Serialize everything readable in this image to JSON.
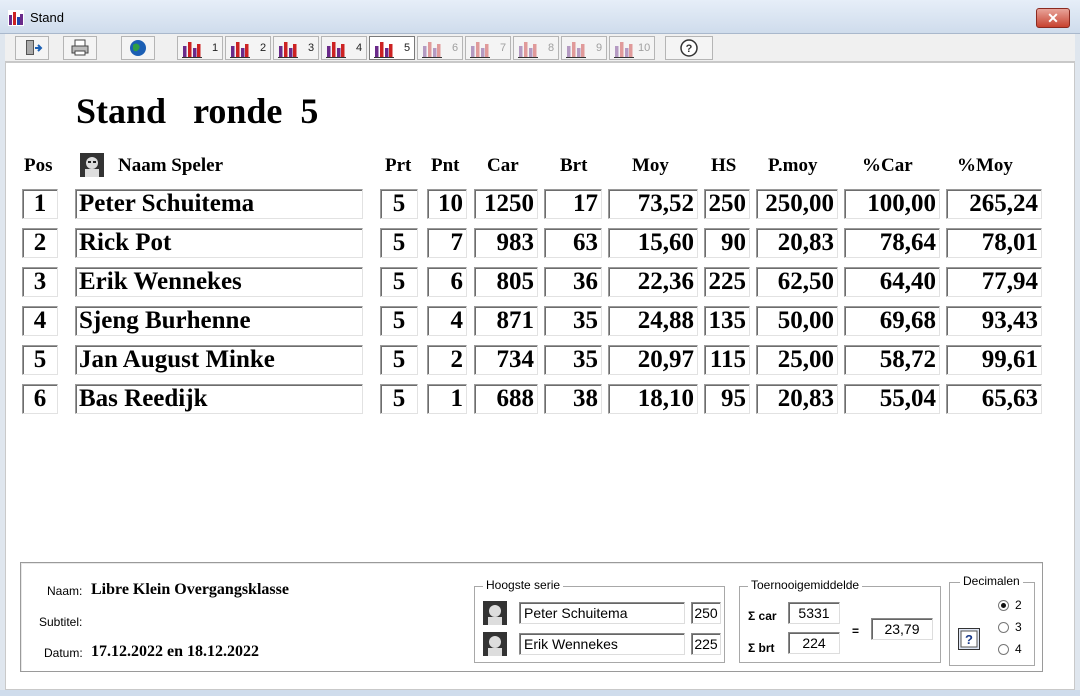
{
  "window": {
    "title": "Stand",
    "close_glyph": "✕"
  },
  "toolbar": {
    "round_numbers": [
      "1",
      "2",
      "3",
      "4",
      "5",
      "6",
      "7",
      "8",
      "9",
      "10"
    ],
    "active_round": "5",
    "help_glyph": "?"
  },
  "heading": {
    "word": "Stand",
    "round_word": "ronde",
    "round_number": "5"
  },
  "columns": {
    "pos": "Pos",
    "name": "Naam Speler",
    "prt": "Prt",
    "pnt": "Pnt",
    "car": "Car",
    "brt": "Brt",
    "moy": "Moy",
    "hs": "HS",
    "pmoy": "P.moy",
    "pcar": "%Car",
    "pmoy2": "%Moy"
  },
  "rows": [
    {
      "pos": "1",
      "name": "Peter Schuitema",
      "prt": "5",
      "pnt": "10",
      "car": "1250",
      "brt": "17",
      "moy": "73,52",
      "hs": "250",
      "pmoy": "250,00",
      "pcar": "100,00",
      "pmoy2": "265,24"
    },
    {
      "pos": "2",
      "name": "Rick Pot",
      "prt": "5",
      "pnt": "7",
      "car": "983",
      "brt": "63",
      "moy": "15,60",
      "hs": "90",
      "pmoy": "20,83",
      "pcar": "78,64",
      "pmoy2": "78,01"
    },
    {
      "pos": "3",
      "name": "Erik Wennekes",
      "prt": "5",
      "pnt": "6",
      "car": "805",
      "brt": "36",
      "moy": "22,36",
      "hs": "225",
      "pmoy": "62,50",
      "pcar": "64,40",
      "pmoy2": "77,94"
    },
    {
      "pos": "4",
      "name": "Sjeng Burhenne",
      "prt": "5",
      "pnt": "4",
      "car": "871",
      "brt": "35",
      "moy": "24,88",
      "hs": "135",
      "pmoy": "50,00",
      "pcar": "69,68",
      "pmoy2": "93,43"
    },
    {
      "pos": "5",
      "name": "Jan August Minke",
      "prt": "5",
      "pnt": "2",
      "car": "734",
      "brt": "35",
      "moy": "20,97",
      "hs": "115",
      "pmoy": "25,00",
      "pcar": "58,72",
      "pmoy2": "99,61"
    },
    {
      "pos": "6",
      "name": "Bas Reedijk",
      "prt": "5",
      "pnt": "1",
      "car": "688",
      "brt": "38",
      "moy": "18,10",
      "hs": "95",
      "pmoy": "20,83",
      "pcar": "55,04",
      "pmoy2": "65,63"
    }
  ],
  "info": {
    "naam_label": "Naam:",
    "naam": "Libre Klein Overgangsklasse",
    "subtitel_label": "Subtitel:",
    "subtitel": "",
    "datum_label": "Datum:",
    "datum": "17.12.2022 en 18.12.2022"
  },
  "hoogste_serie": {
    "title": "Hoogste serie",
    "entries": [
      {
        "name": "Peter Schuitema",
        "value": "250"
      },
      {
        "name": "Erik Wennekes",
        "value": "225"
      }
    ]
  },
  "toernooi": {
    "title": "Toernooigemiddelde",
    "car_label": "Σ car",
    "car": "5331",
    "brt_label": "Σ brt",
    "brt": "224",
    "eq": "=",
    "result": "23,79"
  },
  "decimalen": {
    "title": "Decimalen",
    "options": [
      "2",
      "3",
      "4"
    ],
    "selected": "2",
    "help_glyph": "?"
  },
  "colors": {
    "title_bar": "#cfdcec",
    "close": "#c7422f",
    "bar_purple": "#6a2a8a",
    "bar_red": "#cc2222"
  }
}
